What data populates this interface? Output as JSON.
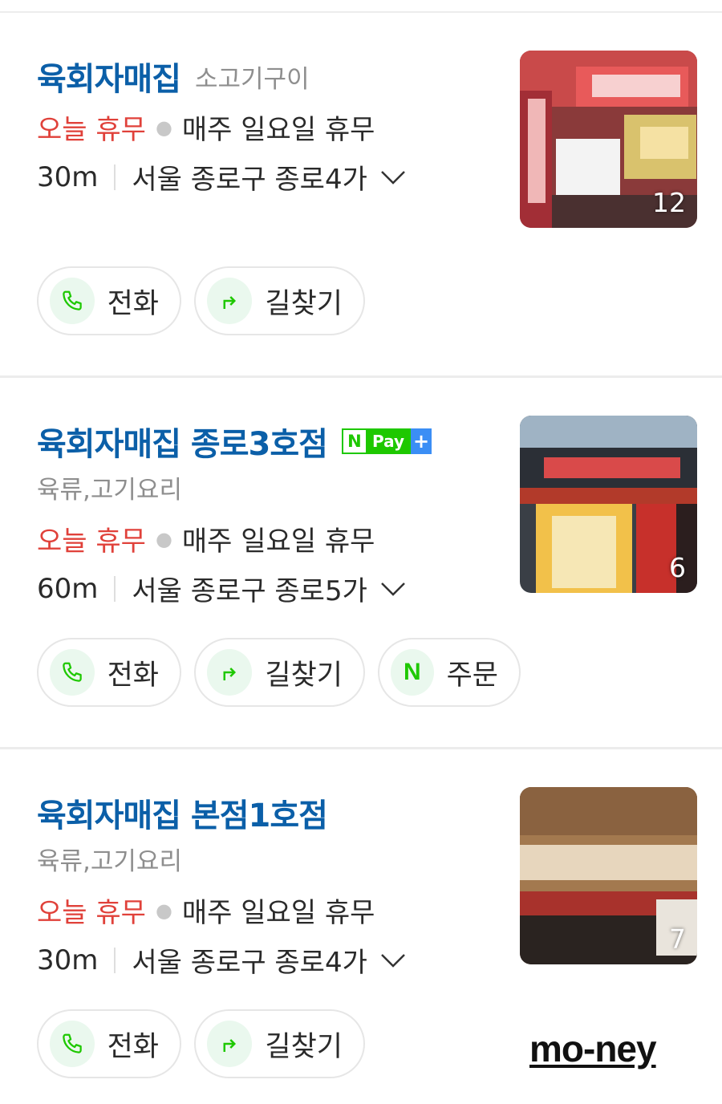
{
  "listings": [
    {
      "name": "육회자매집",
      "category": "소고기구이",
      "status_closed": "오늘 휴무",
      "hours": "매주 일요일 휴무",
      "distance": "30m",
      "address": "서울 종로구 종로4가",
      "photo_count": "12",
      "buttons": {
        "call": "전화",
        "directions": "길찾기"
      }
    },
    {
      "name": "육회자매집 종로3호점",
      "npay_badge": {
        "n": "N",
        "pay": "Pay",
        "plus": "+"
      },
      "category": "육류,고기요리",
      "status_closed": "오늘 휴무",
      "hours": "매주 일요일 휴무",
      "distance": "60m",
      "address": "서울 종로구 종로5가",
      "photo_count": "6",
      "buttons": {
        "call": "전화",
        "directions": "길찾기",
        "order_icon": "N",
        "order": "주문"
      }
    },
    {
      "name": "육회자매집 본점1호점",
      "category": "육류,고기요리",
      "status_closed": "오늘 휴무",
      "hours": "매주 일요일 휴무",
      "distance": "30m",
      "address": "서울 종로구 종로4가",
      "photo_count": "7",
      "buttons": {
        "call": "전화",
        "directions": "길찾기"
      }
    }
  ],
  "watermark": "mo-ney",
  "colors": {
    "title_blue": "#0b5fa8",
    "closed_red": "#e0413a",
    "naver_green": "#1ec800",
    "icon_bg": "#eaf8ee"
  },
  "icons": {
    "call": "phone-icon",
    "directions": "turn-arrow-icon",
    "expand": "chevron-down-icon",
    "order": "naver-n-icon"
  }
}
